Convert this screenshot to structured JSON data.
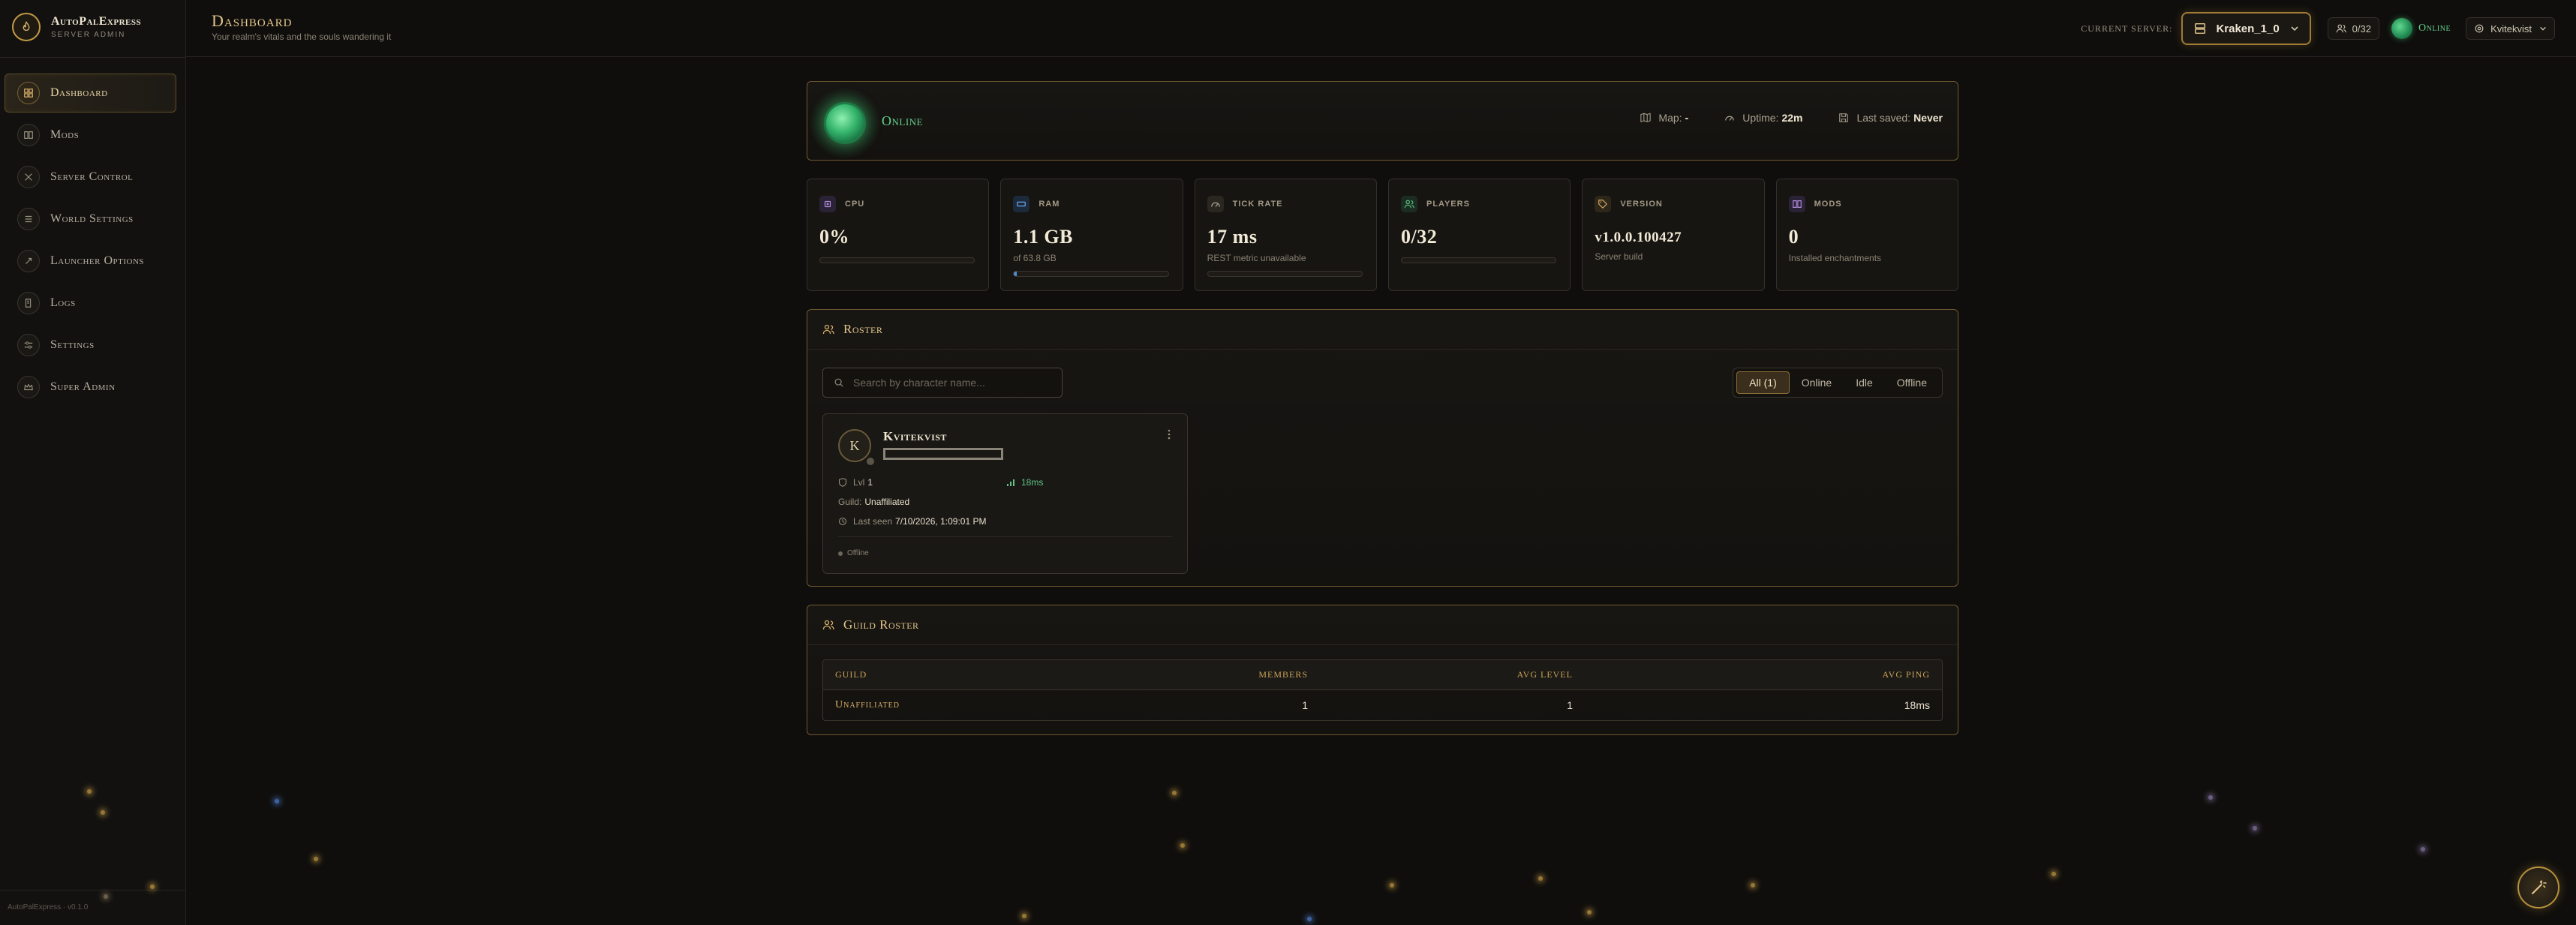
{
  "brand": {
    "name": "AutoPalExpress",
    "subtitle": "SERVER ADMIN"
  },
  "sidebar": {
    "items": [
      {
        "label": "Dashboard",
        "icon": "grid-icon",
        "active": true
      },
      {
        "label": "Mods",
        "icon": "book-icon"
      },
      {
        "label": "Server Control",
        "icon": "tools-icon"
      },
      {
        "label": "World Settings",
        "icon": "list-icon"
      },
      {
        "label": "Launcher Options",
        "icon": "rocket-icon"
      },
      {
        "label": "Logs",
        "icon": "scroll-icon"
      },
      {
        "label": "Settings",
        "icon": "sliders-icon"
      },
      {
        "label": "Super Admin",
        "icon": "crown-icon"
      }
    ],
    "footer": "AutoPalExpress · v0.1.0"
  },
  "header": {
    "title": "Dashboard",
    "subtitle": "Your realm's vitals and the souls wandering it",
    "current_server_label": "CURRENT SERVER:",
    "server_name": "Kraken_1_0",
    "player_count": "0/32",
    "status": "Online",
    "user": "Kvitekvist"
  },
  "status_panel": {
    "status": "Online",
    "map_label": "Map:",
    "map_value": "-",
    "uptime_label": "Uptime:",
    "uptime_value": "22m",
    "saved_label": "Last saved:",
    "saved_value": "Never"
  },
  "stats": {
    "cpu": {
      "label": "CPU",
      "value": "0%",
      "bar_fraction": 0.0
    },
    "ram": {
      "label": "RAM",
      "value": "1.1 GB",
      "sub": "of 63.8 GB",
      "bar_fraction": 0.017
    },
    "tick": {
      "label": "TICK RATE",
      "value": "17 ms",
      "sub": "REST metric unavailable",
      "bar_fraction": 0.0
    },
    "players": {
      "label": "PLAYERS",
      "value": "0/32",
      "bar_fraction": 0.0
    },
    "version": {
      "label": "VERSION",
      "value": "v1.0.0.100427",
      "sub": "Server build"
    },
    "mods": {
      "label": "MODS",
      "value": "0",
      "sub": "Installed enchantments"
    }
  },
  "roster": {
    "title": "Roster",
    "search_placeholder": "Search by character name...",
    "filters": [
      "All (1)",
      "Online",
      "Idle",
      "Offline"
    ],
    "active_filter": 0,
    "players": [
      {
        "initial": "K",
        "name": "Kvitekvist",
        "level_label": "Lvl",
        "level": "1",
        "ping": "18ms",
        "guild_label": "Guild:",
        "guild": "Unaffiliated",
        "last_seen_label": "Last seen",
        "last_seen": "7/10/2026, 1:09:01 PM",
        "status": "Offline"
      }
    ]
  },
  "guild_roster": {
    "title": "Guild Roster",
    "columns": [
      "GUILD",
      "MEMBERS",
      "AVG LEVEL",
      "AVG PING"
    ],
    "rows": [
      {
        "guild": "Unaffiliated",
        "members": "1",
        "avg_level": "1",
        "avg_ping": "18ms"
      }
    ]
  },
  "colors": {
    "accent_gold": "#c49a45",
    "online_green": "#63cf8c",
    "background": "#0f0e0c"
  }
}
